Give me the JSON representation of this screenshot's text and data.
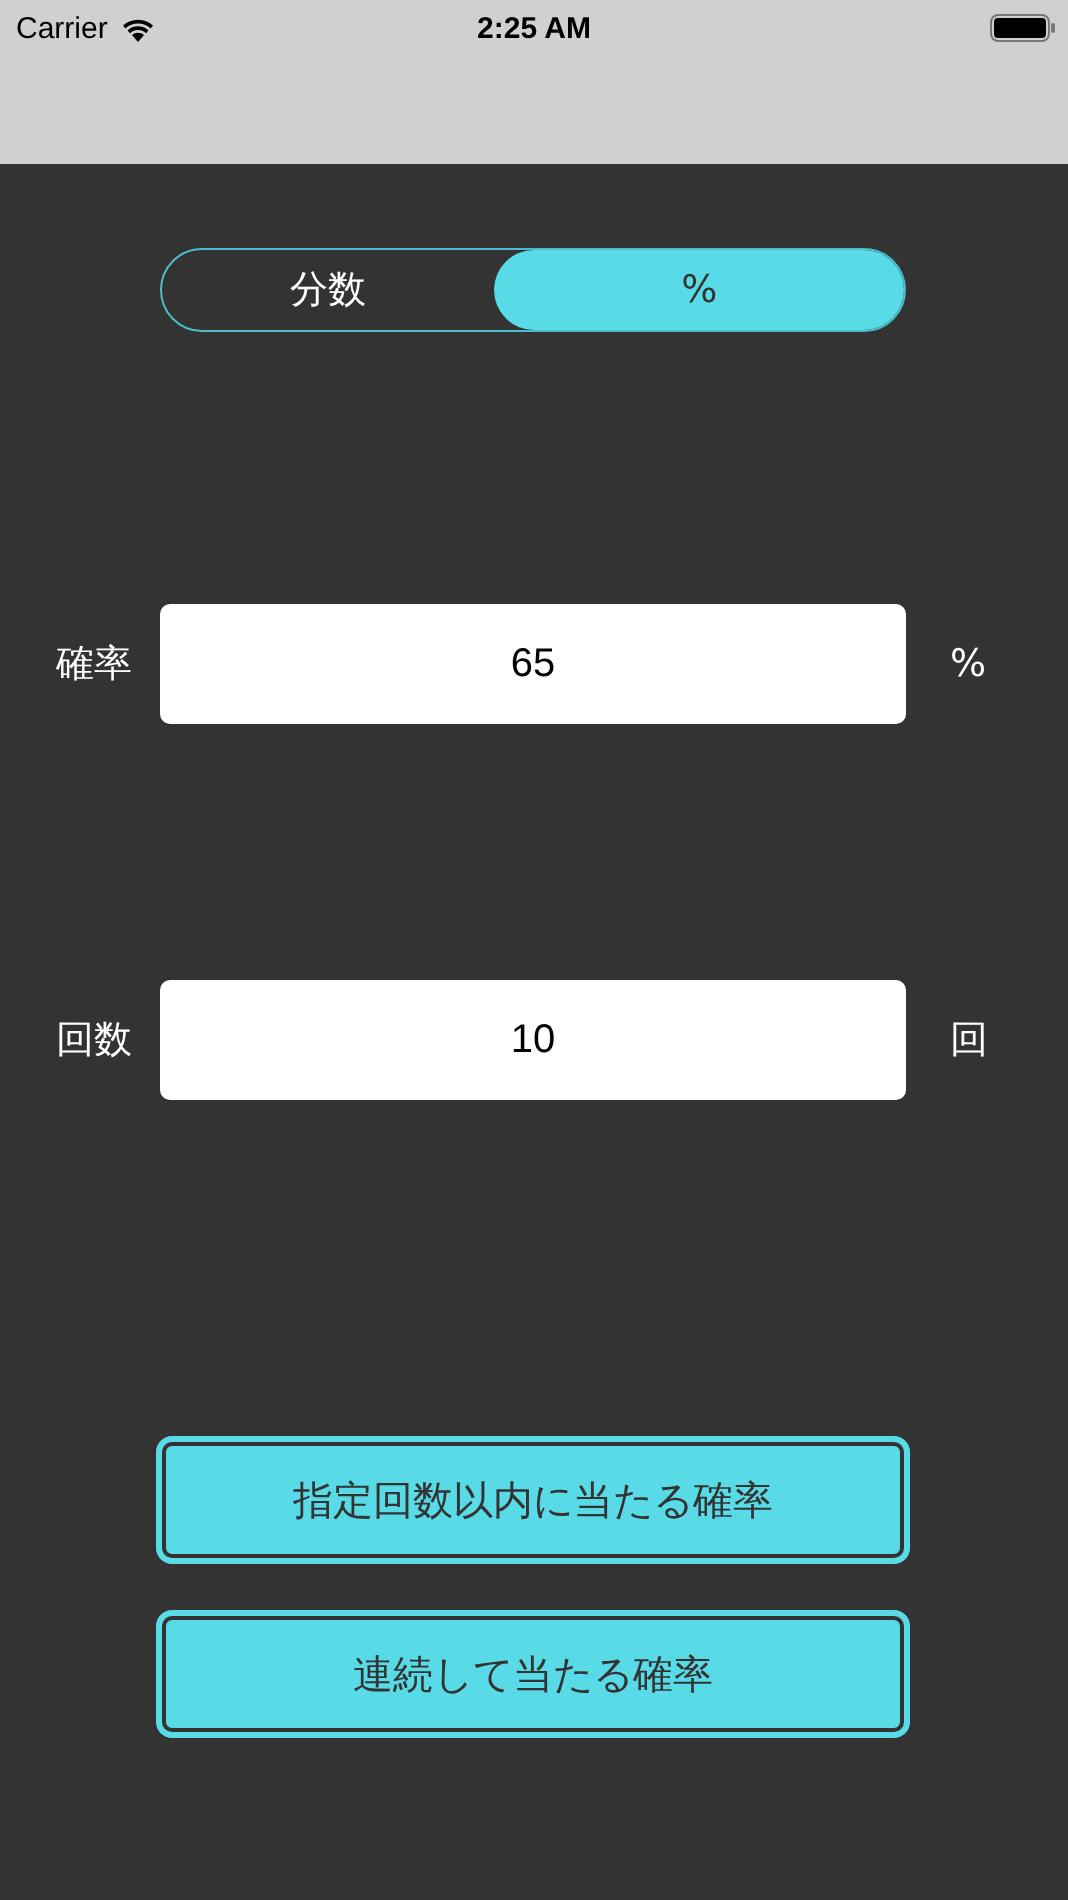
{
  "status_bar": {
    "carrier": "Carrier",
    "time": "2:25 AM"
  },
  "mode_tabs": [
    {
      "label": "分数",
      "selected": false
    },
    {
      "label": "%",
      "selected": true
    }
  ],
  "fields": [
    {
      "label": "確率",
      "value": "65",
      "unit": "%"
    },
    {
      "label": "回数",
      "value": "10",
      "unit": "回"
    }
  ],
  "buttons": [
    "指定回数以内に当たる確率",
    "連続して当たる確率"
  ]
}
